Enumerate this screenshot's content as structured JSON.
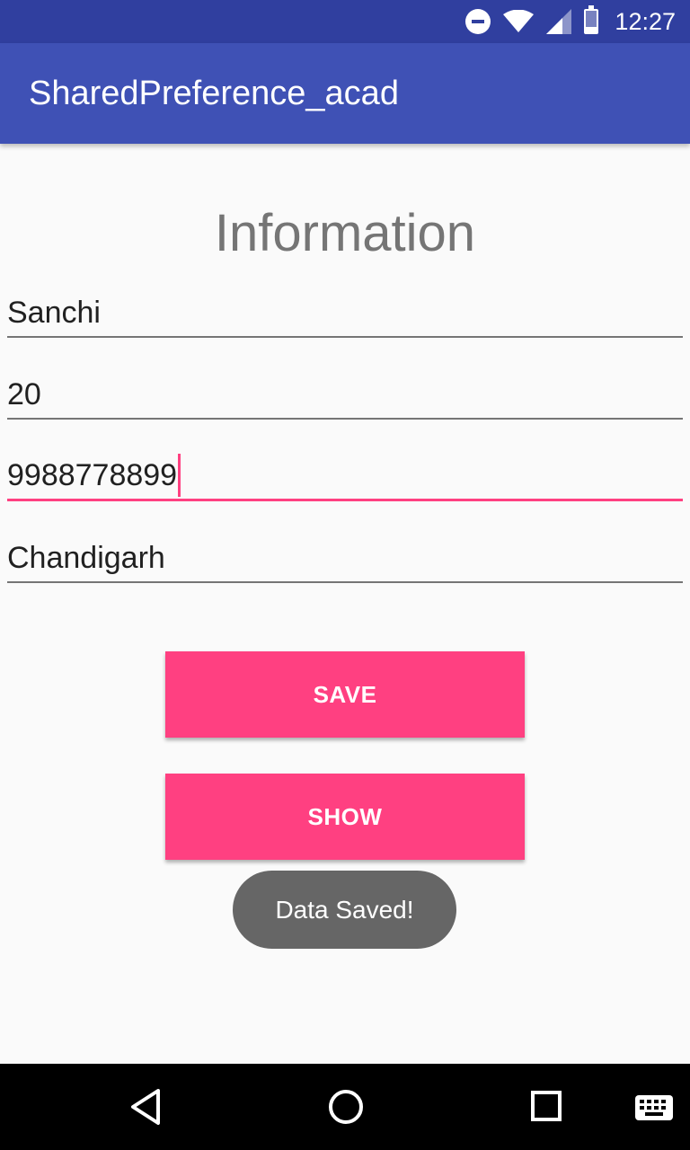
{
  "status_bar": {
    "time": "12:27",
    "icons": [
      "do-not-disturb-icon",
      "wifi-icon",
      "cell-signal-icon",
      "battery-icon"
    ]
  },
  "app_bar": {
    "title": "SharedPreference_acad",
    "color": "#3f51b5"
  },
  "form": {
    "heading": "Information",
    "fields": [
      {
        "name": "name",
        "value": "Sanchi"
      },
      {
        "name": "age",
        "value": "20"
      },
      {
        "name": "phone",
        "value": "9988778899",
        "focused": true
      },
      {
        "name": "city",
        "value": "Chandigarh"
      }
    ]
  },
  "buttons": {
    "save_label": "SAVE",
    "show_label": "SHOW",
    "accent_color": "#ff4081"
  },
  "toast": {
    "message": "Data Saved!"
  },
  "nav_bar": {
    "icons": [
      "back-icon",
      "home-icon",
      "recents-icon",
      "keyboard-icon"
    ]
  }
}
